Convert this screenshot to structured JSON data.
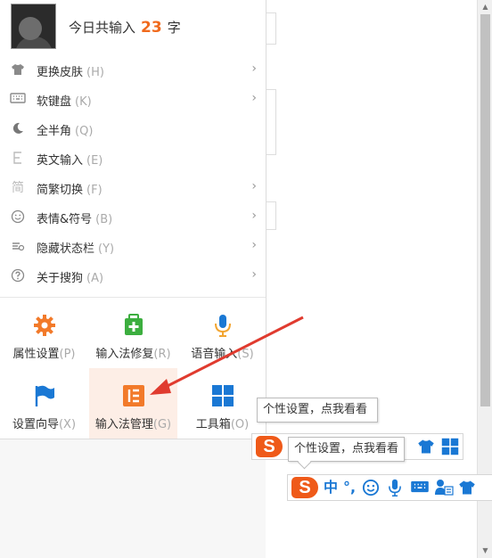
{
  "header": {
    "prefix": "今日共输入",
    "count": "23",
    "suffix": "字"
  },
  "menu_items": [
    {
      "label": "更换皮肤",
      "shortcut": "(H)",
      "icon": "shirt-icon",
      "submenu": true
    },
    {
      "label": "软键盘",
      "shortcut": "(K)",
      "icon": "keyboard-icon",
      "submenu": true
    },
    {
      "label": "全半角",
      "shortcut": "(Q)",
      "icon": "moon-icon",
      "submenu": false
    },
    {
      "label": "英文输入",
      "shortcut": "(E)",
      "icon": "letter-e-icon",
      "submenu": false
    },
    {
      "label": "简繁切换",
      "shortcut": "(F)",
      "icon": "jian-icon",
      "submenu": true
    },
    {
      "label": "表情&符号",
      "shortcut": "(B)",
      "icon": "smiley-icon",
      "submenu": true
    },
    {
      "label": "隐藏状态栏",
      "shortcut": "(Y)",
      "icon": "hide-status-icon",
      "submenu": true
    },
    {
      "label": "关于搜狗",
      "shortcut": "(A)",
      "icon": "question-icon",
      "submenu": true
    }
  ],
  "grid": [
    {
      "label": "属性设置",
      "shortcut": "(P)",
      "icon": "gear-icon"
    },
    {
      "label": "输入法修复",
      "shortcut": "(R)",
      "icon": "repair-icon"
    },
    {
      "label": "语音输入",
      "shortcut": "(S)",
      "icon": "microphone-icon"
    },
    {
      "label": "设置向导",
      "shortcut": "(X)",
      "icon": "flag-icon"
    },
    {
      "label": "输入法管理",
      "shortcut": "(G)",
      "icon": "manager-icon"
    },
    {
      "label": "工具箱",
      "shortcut": "(O)",
      "icon": "toolbox-icon"
    }
  ],
  "tooltip_back": "个性设置，点我看看",
  "tooltip_front": "个性设置，点我看看",
  "statusbar": {
    "logo": "S",
    "mode": "中",
    "punct": "°,"
  },
  "colors": {
    "accent": "#ef5a19",
    "blue": "#1a78d4",
    "arrow": "#e03b2f"
  }
}
